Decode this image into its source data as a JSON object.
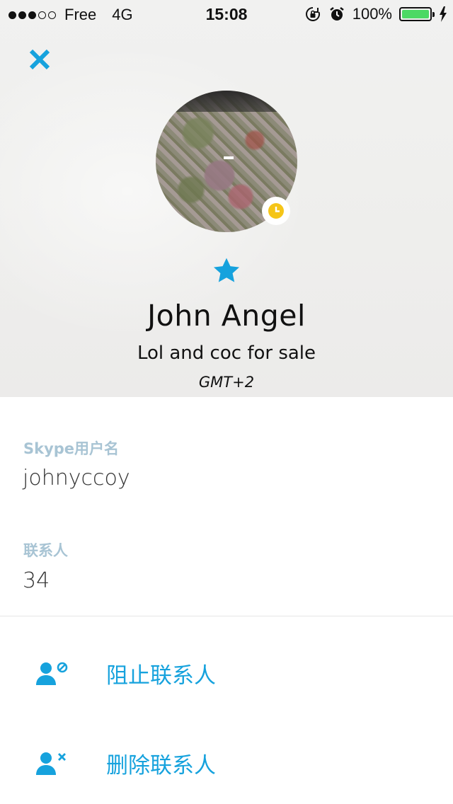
{
  "status_bar": {
    "carrier": "Free",
    "network": "4G",
    "time": "15:08",
    "battery": "100%"
  },
  "profile": {
    "name": "John Angel",
    "mood": "Lol and coc for sale",
    "timezone": "GMT+2",
    "favorite": true,
    "presence": "away"
  },
  "info": {
    "username_label": "Skype用户名",
    "username_value": "johnyccoy",
    "contacts_label": "联系人",
    "contacts_value": "34"
  },
  "actions": {
    "block_label": "阻止联系人",
    "delete_label": "删除联系人"
  },
  "colors": {
    "accent": "#16a2dd",
    "label": "#a8c4d4",
    "presence_away": "#f5c518",
    "battery": "#4cd964"
  },
  "icons": {
    "close": "close-icon",
    "favorite": "star-icon",
    "presence": "clock-icon",
    "block": "block-contact-icon",
    "delete": "remove-contact-icon"
  }
}
